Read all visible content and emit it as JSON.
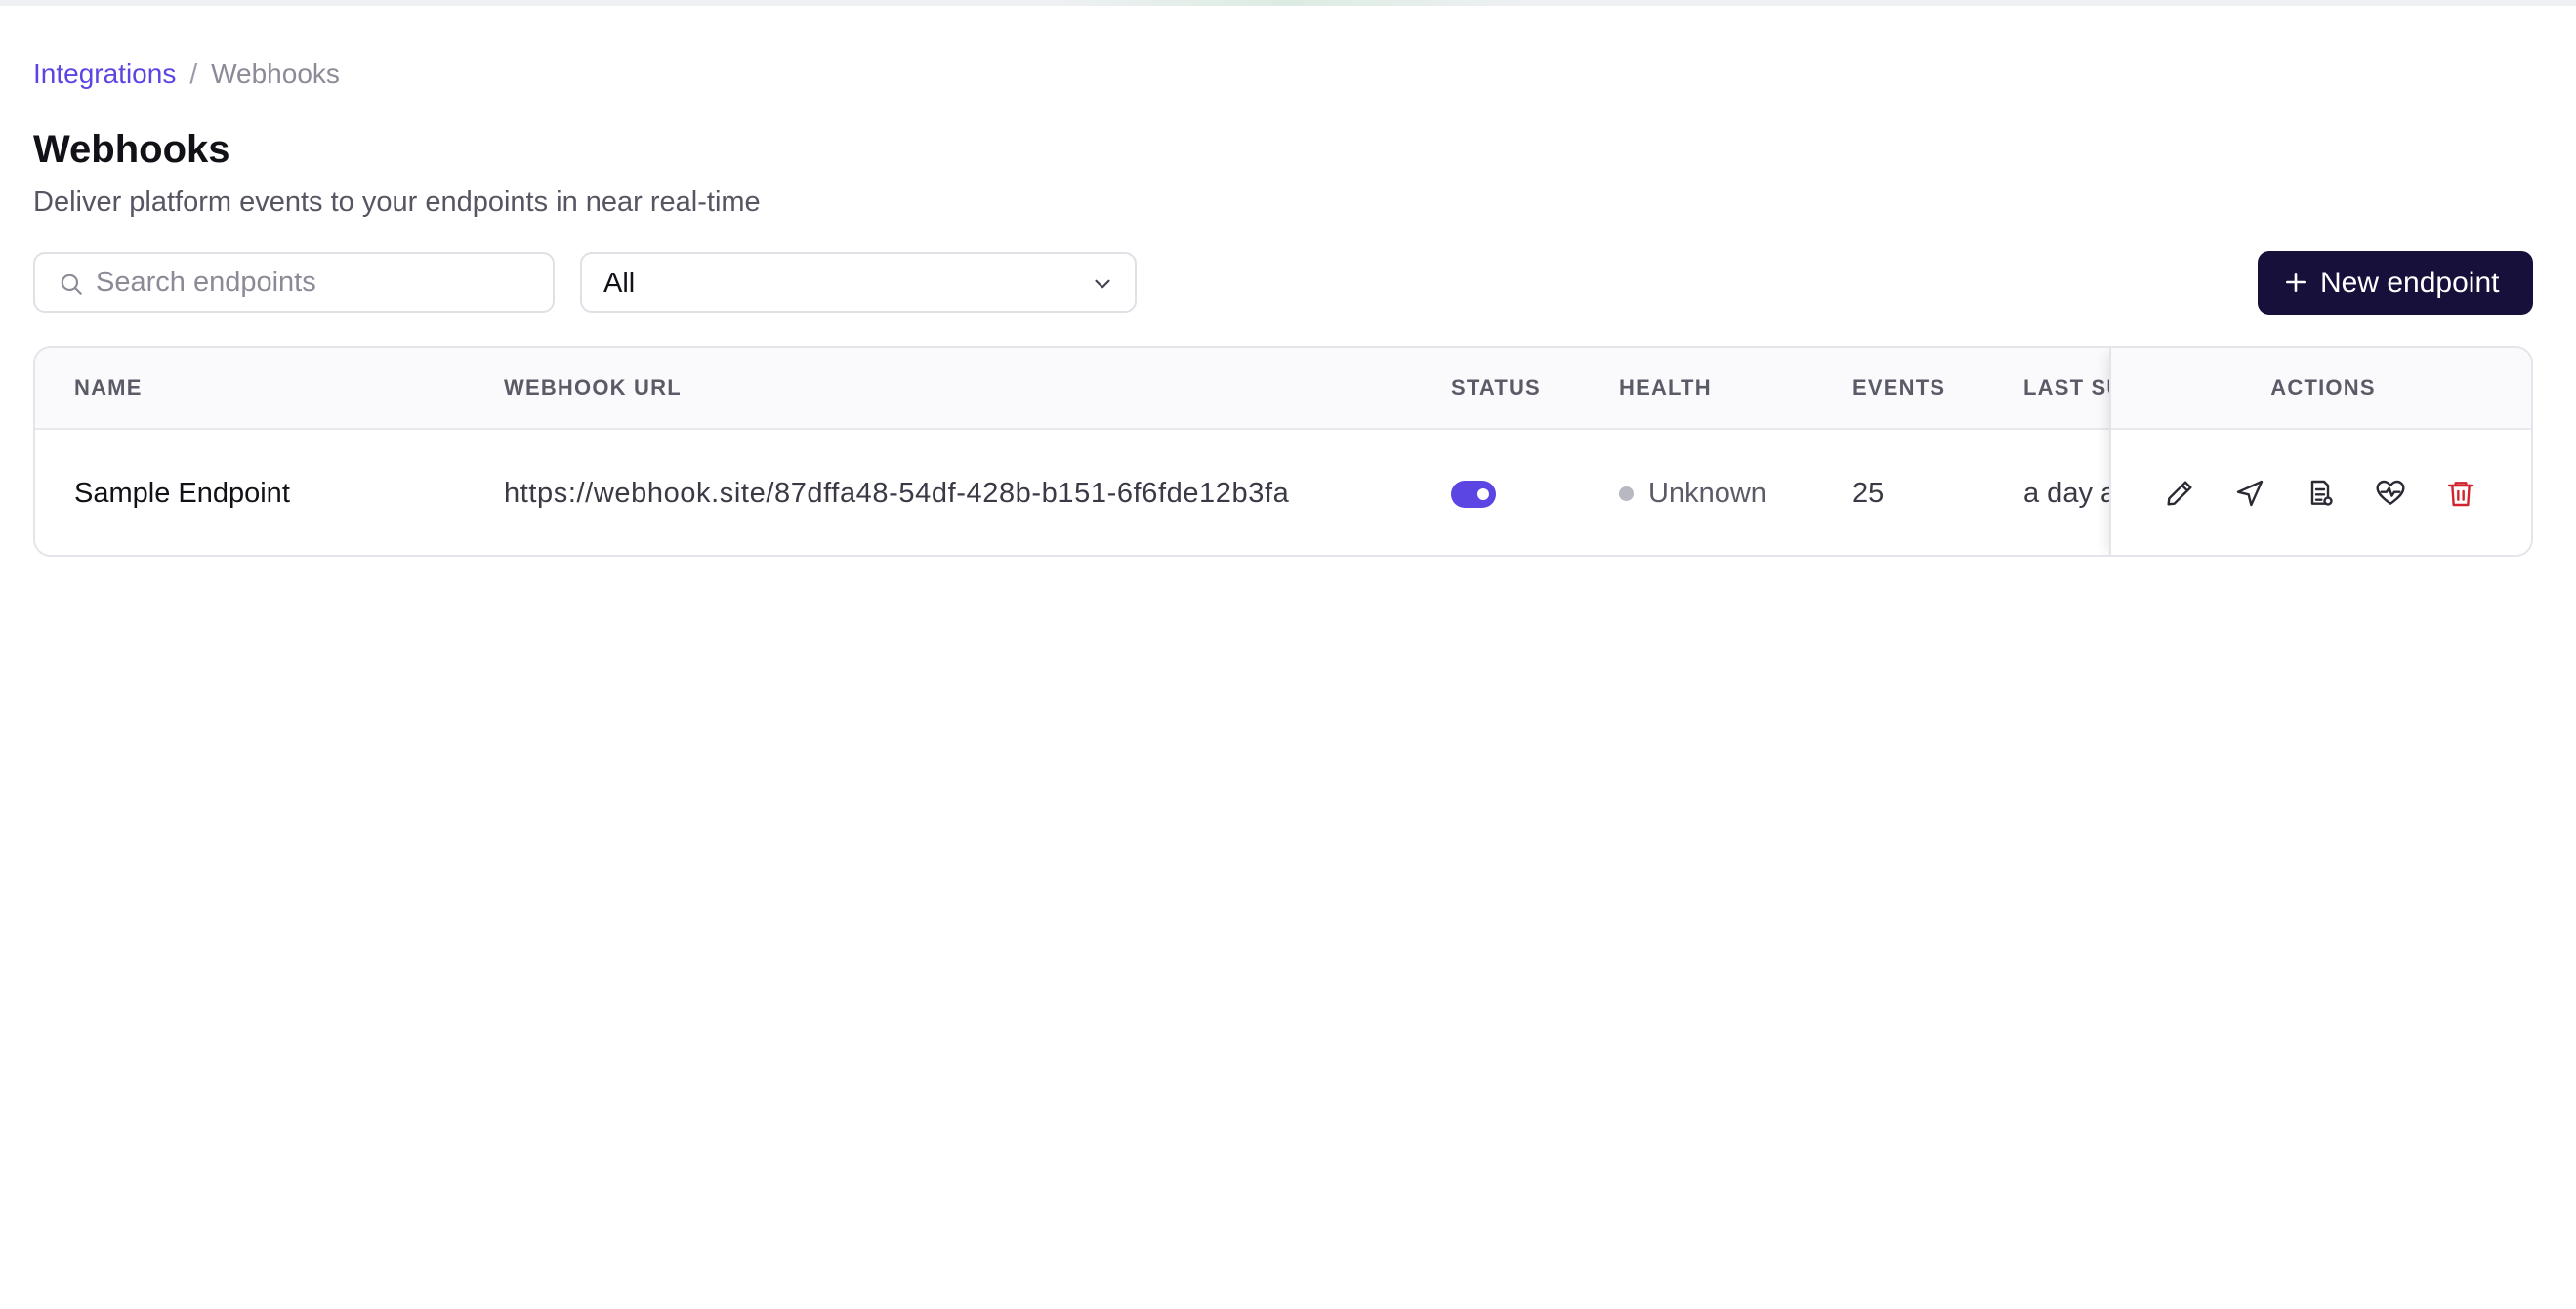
{
  "breadcrumb": {
    "parent": "Integrations",
    "separator": "/",
    "current": "Webhooks"
  },
  "header": {
    "title": "Webhooks",
    "subtitle": "Deliver platform events to your endpoints in near real-time"
  },
  "toolbar": {
    "search_placeholder": "Search endpoints",
    "search_value": "",
    "filter_value": "All",
    "new_button_label": "New endpoint"
  },
  "table": {
    "columns": {
      "name": "NAME",
      "url": "WEBHOOK URL",
      "status": "STATUS",
      "health": "HEALTH",
      "events": "EVENTS",
      "last": "LAST SUCCESS",
      "actions": "ACTIONS"
    },
    "rows": [
      {
        "name": "Sample Endpoint",
        "url": "https://webhook.site/87dffa48-54df-428b-b151-6f6fde12b3fa",
        "status_enabled": true,
        "health": "Unknown",
        "events": "25",
        "last": "a day ago"
      }
    ],
    "row_actions": [
      "edit-icon",
      "send-icon",
      "logs-icon",
      "heartbeat-icon",
      "delete-icon"
    ]
  },
  "colors": {
    "accent": "#5b46e4",
    "primary_button": "#16103a",
    "danger": "#d1242f",
    "health_unknown": "#b8b8c2"
  }
}
